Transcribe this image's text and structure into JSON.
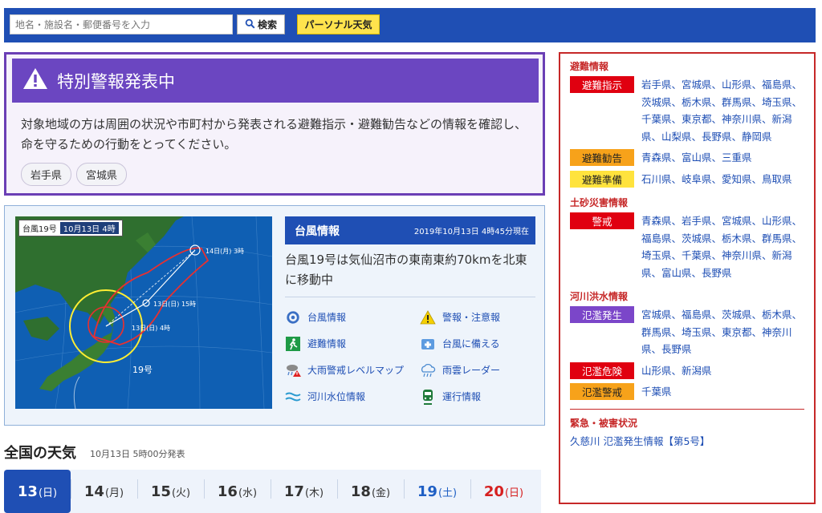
{
  "search": {
    "placeholder": "地名・施設名・郵便番号を入力",
    "button_label": "検索",
    "personal_label": "パーソナル天気"
  },
  "special_warning": {
    "title": "特別警報発表中",
    "text": "対象地域の方は周囲の状況や市町村から発表される避難指示・避難勧告などの情報を確認し、命を守るための行動をとってください。",
    "prefectures": [
      "岩手県",
      "宮城県"
    ]
  },
  "typhoon": {
    "map_label": "台風19号",
    "map_date": "10月13日 4時",
    "map_pos_14": "14日(月) 3時",
    "map_pos_13a": "13日(日) 15時",
    "map_pos_13b": "13日(日) 4時",
    "map_name": "19号",
    "header_title": "台風情報",
    "header_date": "2019年10月13日 4時45分現在",
    "description": "台風19号は気仙沼市の東南東約70kmを北東に移動中",
    "links": [
      {
        "label": "台風情報",
        "icon": "typhoon-icon"
      },
      {
        "label": "警報・注意報",
        "icon": "warning-icon"
      },
      {
        "label": "避難情報",
        "icon": "evacuation-icon"
      },
      {
        "label": "台風に備える",
        "icon": "first-aid-icon"
      },
      {
        "label": "大雨警戒レベルマップ",
        "icon": "rain-alert-icon"
      },
      {
        "label": "雨雲レーダー",
        "icon": "rain-cloud-icon"
      },
      {
        "label": "河川水位情報",
        "icon": "river-icon"
      },
      {
        "label": "運行情報",
        "icon": "train-icon"
      }
    ]
  },
  "national": {
    "title": "全国の天気",
    "subtitle": "10月13日 5時00分発表",
    "days": [
      {
        "num": "13",
        "dow": "(日)",
        "type": "active"
      },
      {
        "num": "14",
        "dow": "(月)",
        "type": ""
      },
      {
        "num": "15",
        "dow": "(火)",
        "type": ""
      },
      {
        "num": "16",
        "dow": "(水)",
        "type": ""
      },
      {
        "num": "17",
        "dow": "(木)",
        "type": ""
      },
      {
        "num": "18",
        "dow": "(金)",
        "type": ""
      },
      {
        "num": "19",
        "dow": "(土)",
        "type": "sat"
      },
      {
        "num": "20",
        "dow": "(日)",
        "type": "sun"
      }
    ]
  },
  "sidebar": {
    "evac_title": "避難情報",
    "evac_order_label": "避難指示",
    "evac_order_prefs": "岩手県、宮城県、山形県、福島県、茨城県、栃木県、群馬県、埼玉県、千葉県、東京都、神奈川県、新潟県、山梨県、長野県、静岡県",
    "evac_advice_label": "避難勧告",
    "evac_advice_prefs": "青森県、富山県、三重県",
    "evac_prep_label": "避難準備",
    "evac_prep_prefs": "石川県、岐阜県、愛知県、鳥取県",
    "landslide_title": "土砂災害情報",
    "landslide_label": "警戒",
    "landslide_prefs": "青森県、岩手県、宮城県、山形県、福島県、茨城県、栃木県、群馬県、埼玉県、千葉県、神奈川県、新潟県、富山県、長野県",
    "flood_title": "河川洪水情報",
    "flood_occur_label": "氾濫発生",
    "flood_occur_prefs": "宮城県、福島県、茨城県、栃木県、群馬県、埼玉県、東京都、神奈川県、長野県",
    "flood_danger_label": "氾濫危険",
    "flood_danger_prefs": "山形県、新潟県",
    "flood_caution_label": "氾濫警戒",
    "flood_caution_prefs": "千葉県",
    "emergency_title": "緊急・被害状況",
    "emergency_link": "久慈川 氾濫発生情報【第5号】"
  },
  "colors": {
    "brand_blue": "#1f4fb4",
    "special_purple": "#6b46c1",
    "alert_red": "#c62828"
  }
}
